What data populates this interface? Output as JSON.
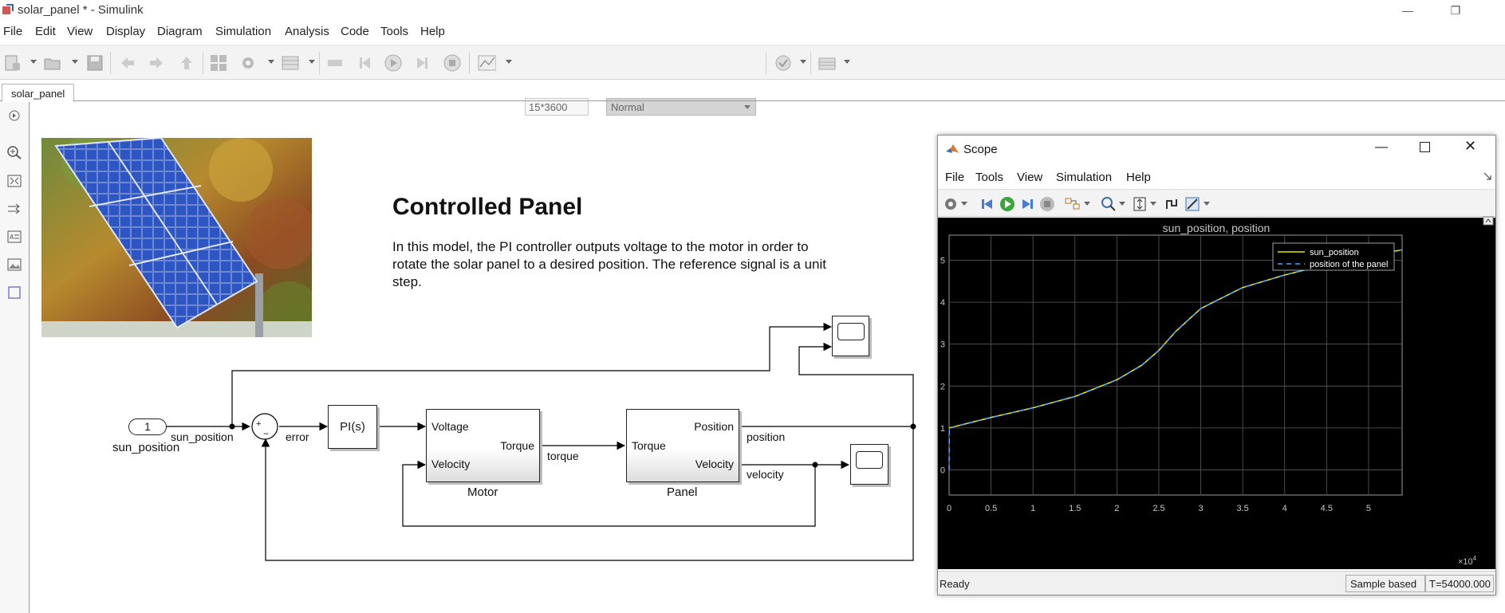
{
  "window": {
    "title": "solar_panel * - Simulink",
    "minimize": "—",
    "restore": "❐",
    "close": "✕"
  },
  "menu": [
    "File",
    "Edit",
    "View",
    "Display",
    "Diagram",
    "Simulation",
    "Analysis",
    "Code",
    "Tools",
    "Help"
  ],
  "toolbar": {
    "stop_time": "15*3600",
    "sim_mode": "Normal"
  },
  "tabs": [
    "solar_panel"
  ],
  "canvas": {
    "title": "Controlled Panel",
    "description": "In this model, the PI controller outputs voltage to the motor in order to rotate the solar panel to a desired position. The reference signal is a unit step."
  },
  "diagram": {
    "inport_number": "1",
    "inport_name": "sun_position",
    "sum_plus": "+",
    "sum_minus": "−",
    "pi_label": "PI(s)",
    "motor_in": "Voltage",
    "motor_in2": "Velocity",
    "motor_out": "Torque",
    "motor_name": "Motor",
    "panel_in": "Torque",
    "panel_out1": "Position",
    "panel_out2": "Velocity",
    "panel_name": "Panel",
    "sig_sun_position": "sun_position",
    "sig_error": "error",
    "sig_torque": "torque",
    "sig_position": "position",
    "sig_velocity": "velocity"
  },
  "scope": {
    "title": "Scope",
    "menu": [
      "File",
      "Tools",
      "View",
      "Simulation",
      "Help"
    ],
    "status_ready": "Ready",
    "status_mode": "Sample based",
    "status_time": "T=54000.000"
  },
  "chart_data": {
    "type": "line",
    "title": "sun_position, position",
    "xlabel": "",
    "ylabel": "",
    "x_multiplier_label": "×10",
    "x_multiplier_exp": "4",
    "xlim": [
      0,
      5.4
    ],
    "ylim": [
      -0.6,
      5.6
    ],
    "x_ticks": [
      "0",
      "0.5",
      "1",
      "1.5",
      "2",
      "2.5",
      "3",
      "3.5",
      "4",
      "4.5",
      "5"
    ],
    "y_ticks": [
      "0",
      "1",
      "2",
      "3",
      "4",
      "5"
    ],
    "grid": true,
    "legend_position": "top-right",
    "background": "#000000",
    "series": [
      {
        "name": "sun_position",
        "color": "#e6e600",
        "style": "solid",
        "x": [
          0,
          0.5,
          1,
          1.5,
          2,
          2.3,
          2.5,
          2.7,
          3,
          3.5,
          4,
          4.5,
          5,
          5.4
        ],
        "y": [
          1.0,
          1.25,
          1.48,
          1.75,
          2.15,
          2.5,
          2.85,
          3.3,
          3.85,
          4.35,
          4.65,
          4.9,
          5.1,
          5.25
        ]
      },
      {
        "name": "position of the panel",
        "color": "#4da6ff",
        "style": "dashed",
        "x": [
          0,
          0.003,
          0.5,
          1,
          1.5,
          2,
          2.3,
          2.5,
          2.7,
          3,
          3.5,
          4,
          4.5,
          5,
          5.4
        ],
        "y": [
          0,
          1.0,
          1.25,
          1.48,
          1.75,
          2.15,
          2.5,
          2.85,
          3.3,
          3.85,
          4.35,
          4.65,
          4.9,
          5.1,
          5.25
        ]
      }
    ]
  }
}
